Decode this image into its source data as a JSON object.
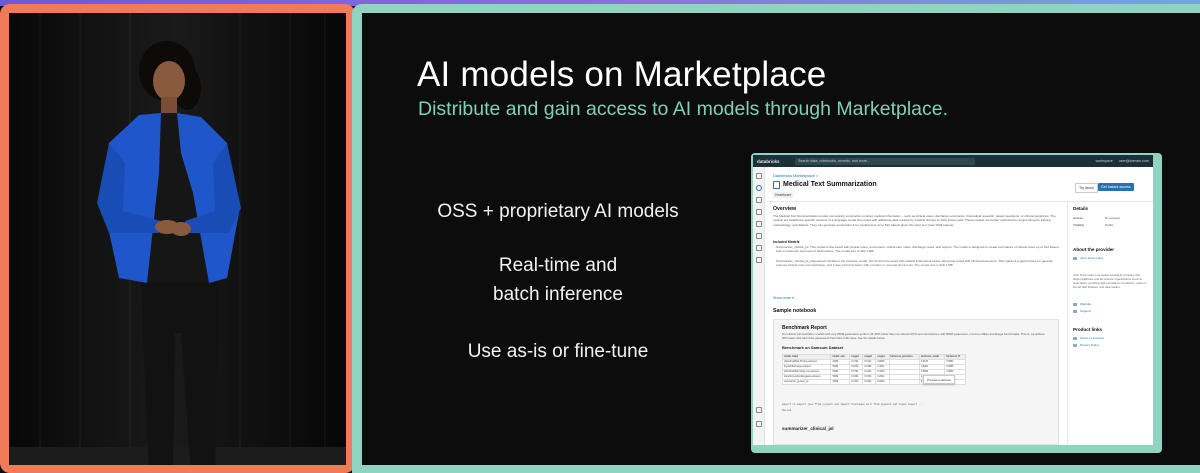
{
  "slide": {
    "title": "AI models on Marketplace",
    "subtitle": "Distribute and gain access to AI models through Marketplace.",
    "bullets": [
      "OSS + proprietary AI models",
      "Real-time and batch inference",
      "Use as-is or fine-tune"
    ],
    "accent_color": "#7fd0b8",
    "frame_color": "#8fd3c0"
  },
  "speaker": {
    "frame_color": "#ef7b57",
    "jacket_color": "#1f56c9"
  },
  "app": {
    "brand": "databricks",
    "search_placeholder": "Search data, notebooks, recents, and more...",
    "shortcut": "⌘ + P",
    "workspace": "workspace",
    "user": "user@domain.com",
    "breadcrumb": "Databricks Marketplace >",
    "listing_title": "Medical Text Summarization",
    "tag": "Healthcare",
    "try_demo": "Try demo",
    "get_access": "Get instant access",
    "overview_heading": "Overview",
    "overview_text": "The Medical Text Summarization models can quickly summarize complex medical information – such as clinical notes, discharge summaries, biomedical research, patient questions, or clinical guidelines. The models are healthcare-specific versions of a language model fine-tuned with additional data curated by medical doctors at John Snow Labs. These models are further optimized by augmenting the training methodology, and dataset. They can generate summaries from medical text up to 512 tokens given the input text (max 1024 tokens).",
    "included_models_heading": "Included Models",
    "included_models": [
      "Summarizer_clinical_jsl: This model is fine-tuned with clinical notes, encounters, critical care notes, discharge notes, and reports. The model is designed to create summaries of clinical notes up to 512 tokens from a maximum input text of 1024 tokens. The model size is 920.1 MB.",
      "Summarizer_clinical_jsl_augmented: Similar to the previous model, but it's first fine-tuned with natural instructions before being fine-tuned with clinical documents. This makes it a good choice for general-purpose clinical note summarization, and it also performs better with complex or unusual documents. The model size is 920.1 MB."
    ],
    "show_more": "Show more ▾",
    "sample_heading": "Sample notebook",
    "notebook": {
      "title": "Benchmark Report",
      "intro": "Our clinical summarization models with only 250M parameters perform 30–35% better than non-clinical SOTA text summarizers with 500M parameters, in terms of Bleu and Rouge benchmarks. That is, we achieve 30% better with half of the parameters that other LLMs have. See the details below.",
      "dataset_heading": "Benchmark on Samsum Dataset",
      "columns": [
        "model_name",
        "model_size",
        "rouge1",
        "rouge2",
        "rougeL",
        "bertscore_precision",
        "bertscore_recall",
        "bertscore_f1"
      ],
      "rows": [
        [
          "philschmid/flan-t5-base-samsum",
          "240M",
          "0.2734",
          "0.1813",
          "0.8938",
          "",
          "0.9133",
          "0.8891"
        ],
        [
          "linydub/bart-large-samsum",
          "500M",
          "0.3060",
          "0.2168",
          "0.3002",
          "",
          "0.8961",
          "0.8865"
        ],
        [
          "philschmid/bart-large-cnn-samsum",
          "500M",
          "0.3794",
          "0.1262",
          "0.3060",
          "",
          "0.8950",
          "0.8842"
        ],
        [
          "transformersbook/pegasus-samsum",
          "500M",
          "0.3049",
          "0.1543",
          "0.2942",
          "",
          "0.8970",
          "0.8838"
        ],
        [
          "summarizer_generic_jsl",
          "250M",
          "0.2703",
          "0.1932",
          "0.2639",
          "",
          "0.8748",
          "0.8857"
        ]
      ],
      "preview_tooltip": "Preview notebook",
      "code_line": "import re   import json   from pyspark.sql import functions as F   from pyspark.sql.types import ...",
      "run_label": "Run cell",
      "section2": "summarizer_clinical_jsl"
    },
    "details": {
      "heading": "Details",
      "access_label": "Access",
      "access_value": "By request",
      "visibility_label": "Visibility",
      "visibility_value": "Public"
    },
    "provider": {
      "heading": "About the provider",
      "name": "John Snow Labs",
      "description": "John Snow Labs is an award-winning AI company that helps healthcare and life science organizations put AI to work faster, providing high-compliance AI platform, state-of-the-art NLP libraries, and data market.",
      "website": "Website",
      "support": "Support"
    },
    "product_links": {
      "heading": "Product links",
      "terms": "Terms of services",
      "privacy": "Privacy Policy"
    }
  }
}
